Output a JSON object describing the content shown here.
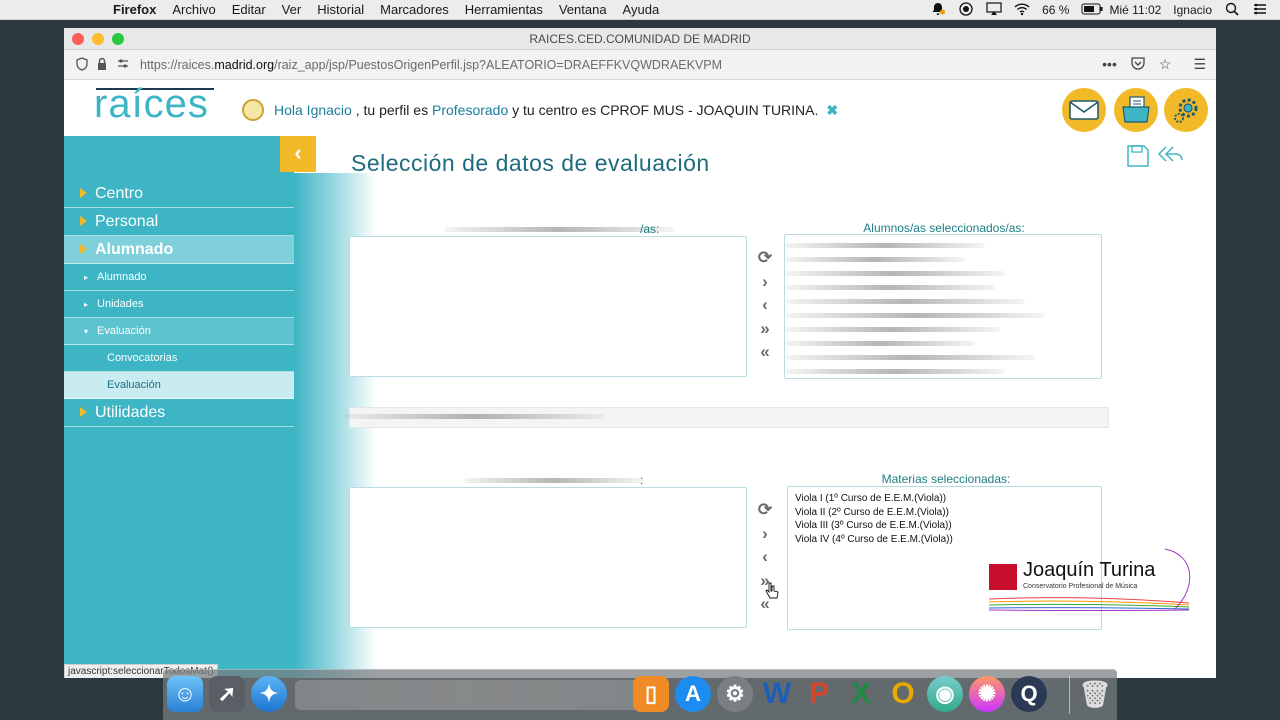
{
  "menubar": {
    "app": "Firefox",
    "items": [
      "Archivo",
      "Editar",
      "Ver",
      "Historial",
      "Marcadores",
      "Herramientas",
      "Ventana",
      "Ayuda"
    ],
    "battery": "66 %",
    "clock": "Mié 11:02",
    "user": "Ignacio"
  },
  "window": {
    "title": "RAICES.CED.COMUNIDAD DE MADRID",
    "url_prefix": "https://raices.",
    "url_domain": "madrid.org",
    "url_path": "/raiz_app/jsp/PuestosOrigenPerfil.jsp?ALEATORIO=DRAEFFKVQWDRAEKVPM"
  },
  "header": {
    "logo": "raíces",
    "greeting_hola": "Hola Ignacio",
    "greeting_mid": " , tu perfil es ",
    "greeting_profile": "Profesorado",
    "greeting_center_text": " y tu centro es CPROF MUS - JOAQUIN TURINA.",
    "close_symbol": "✖"
  },
  "sidebar": {
    "items": [
      {
        "label": "Centro"
      },
      {
        "label": "Personal"
      },
      {
        "label": "Alumnado"
      },
      {
        "label": "Alumnado"
      },
      {
        "label": "Unidades"
      },
      {
        "label": "Evaluación"
      },
      {
        "label": "Convocatorias"
      },
      {
        "label": "Evaluación"
      },
      {
        "label": "Utilidades"
      }
    ]
  },
  "main": {
    "title": "Selección de datos de evaluación",
    "students_available_label_tail": "/as:",
    "students_selected_label": "Alumnos/as seleccionados/as:",
    "subjects_available_label_tail": ":",
    "subjects_selected_label": "Materias seleccionadas:",
    "selected_subjects": [
      "Viola I (1º Curso de E.E.M.(Viola))",
      "Viola II (2º Curso de E.E.M.(Viola))",
      "Viola III (3º Curso de E.E.M.(Viola))",
      "Viola IV (4º Curso de E.E.M.(Viola))"
    ]
  },
  "status_bar": "javascript:seleccionarTodosMat()",
  "school_logo": {
    "name": "Joaquín Turina",
    "subtitle": "Conservatorio Profesional de Música"
  },
  "colors": {
    "brand": "#3db5c4",
    "accent": "#f2b928",
    "title": "#1e6b7f"
  }
}
